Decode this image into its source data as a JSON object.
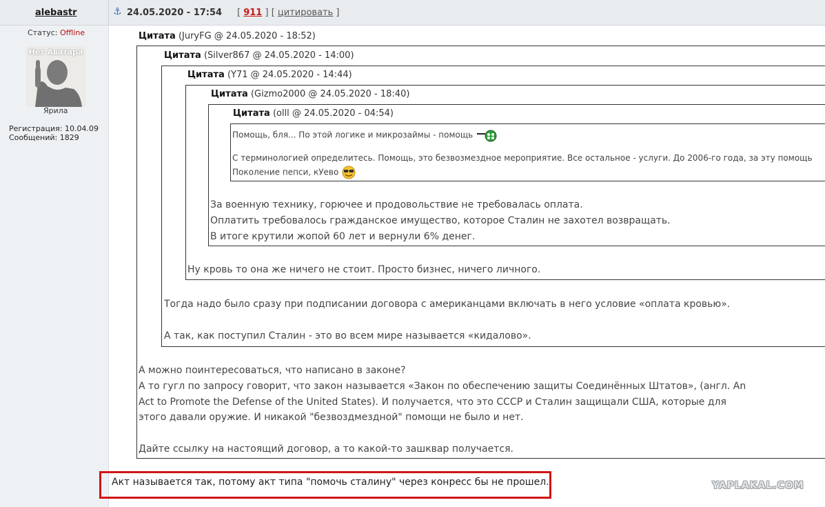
{
  "post": {
    "author": "alebastr",
    "date": "24.05.2020 - 17:54",
    "number": "911",
    "quote_action": "цитировать"
  },
  "user": {
    "status_label": "Статус:",
    "status_value": "Offline",
    "avatar_caption": "Нет Аватара",
    "rank": "Ярила",
    "registration": "Регистрация: 10.04.09",
    "messages": "Сообщений: 1829"
  },
  "quotes": {
    "label": "Цитата",
    "q1_meta": "(JuryFG @ 24.05.2020 - 18:52)",
    "q2_meta": "(Silver867 @ 24.05.2020 - 14:00)",
    "q3_meta": "(Y71 @ 24.05.2020 - 14:44)",
    "q4_meta": "(Gizmo2000 @ 24.05.2020 - 18:40)",
    "q5_meta": "(olll @ 24.05.2020 - 04:54)"
  },
  "texts": {
    "q5_line1": "Помощь, бля... По этой логике и микрозаймы - помощь",
    "q5_line2": "С терминологией определитесь. Помощь, это безвозмездное мероприятие. Все остальное - услуги. До 2006-го года, за эту помощь",
    "q5_line3": "Поколение пепси, кУево",
    "q4_line1": "За военную технику, горючее и продовольствие не требовалась оплата.",
    "q4_line2": "Оплатить требовалось гражданское имущество, которое Сталин не захотел возвращать.",
    "q4_line3": "В итоге крутили жопой 60 лет и вернули 6% денег.",
    "q3_line1": "Ну кровь то она же ничего не стоит. Просто бизнес, ничего личного.",
    "q2_line1": "Тогда надо было сразу при подписании договора с американцами включать в него условие «оплата кровью».",
    "q2_line2": "А так, как поступил Сталин - это во всем мире называется «кидалово».",
    "q1_line1": "А можно поинтересоваться, что написано в законе?",
    "q1_line2": "А то гугл по запросу говорит, что закон называется «Закон по обеспечению защиты Соединённых Штатов», (англ. An",
    "q1_line3": "Act to Promote the Defense of the United States). И получается, что это СССР и Сталин защищали США, которые для",
    "q1_line4": "этого давали оружие. И никакой \"безвоздмездной\" помощи не было и нет.",
    "q1_line5": "Дайте ссылку на настоящий договор, а то какой-то зашквар получается.",
    "reply": "Акт называется так, потому акт типа \"помочь сталину\" через конресс бы не прошел."
  },
  "watermark": "YAPLAKAL.COM",
  "colors": {
    "accent_red": "#d01414",
    "link_blue": "#2f6fb5",
    "offline": "#b01010"
  },
  "icons": [
    "anchor-icon",
    "clover-smiley-icon",
    "sunglasses-smiley-icon"
  ]
}
